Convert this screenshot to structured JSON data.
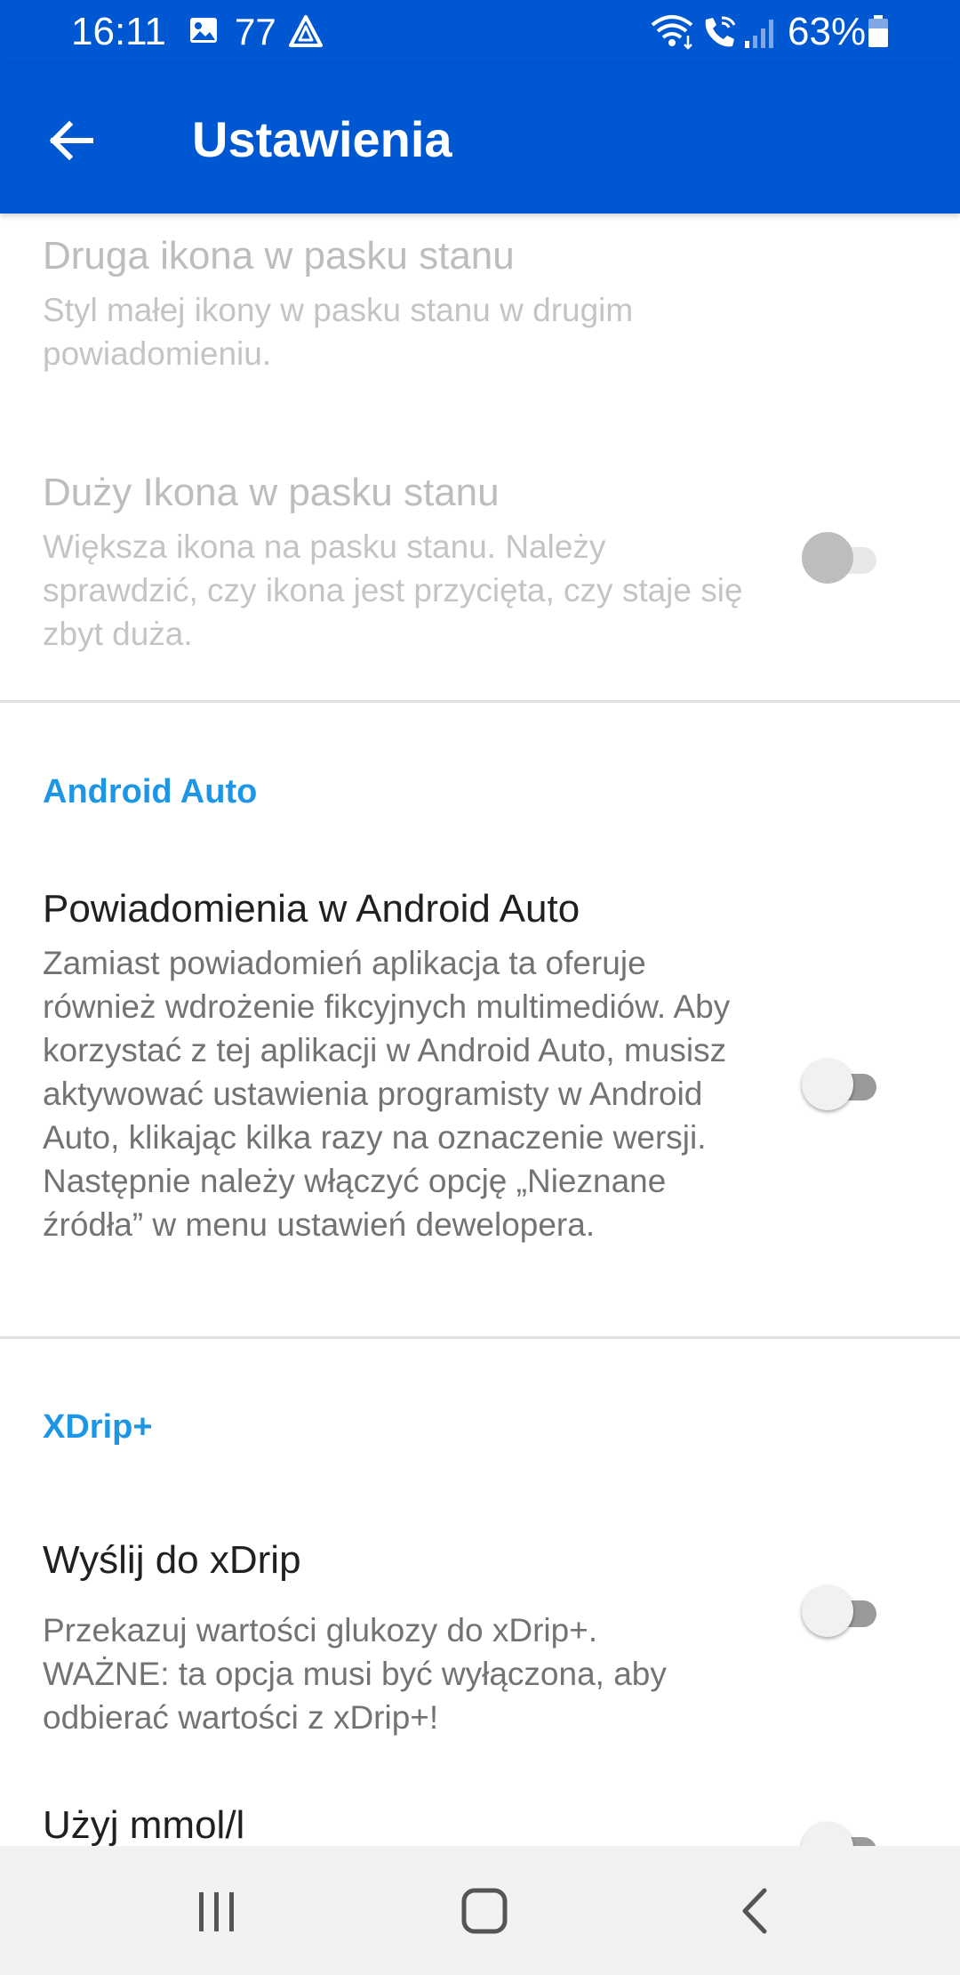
{
  "status_bar": {
    "time": "16:11",
    "notification_count": "77",
    "battery": "63%"
  },
  "app_bar": {
    "title": "Ustawienia"
  },
  "settings": {
    "second_icon": {
      "title": "Druga ikona w pasku stanu",
      "summary": "Styl małej ikony w pasku stanu w drugim powiadomieniu.",
      "enabled": false
    },
    "large_icon": {
      "title": "Duży Ikona w pasku stanu",
      "summary": "Większa ikona na pasku stanu. Należy sprawdzić, czy ikona jest przycięta, czy staje się zbyt duża.",
      "enabled": false,
      "checked": false
    },
    "android_auto_category": "Android Auto",
    "android_auto_notifications": {
      "title": "Powiadomienia w Android Auto",
      "summary": "Zamiast powiadomień aplikacja ta oferuje również wdrożenie fikcyjnych multimediów. Aby korzystać z tej aplikacji w Android Auto, musisz aktywować ustawienia programisty w Android Auto, klikając kilka razy na oznaczenie wersji. Następnie należy włączyć opcję „Nieznane źródła” w menu ustawień dewelopera.",
      "checked": false
    },
    "xdrip_category": "XDrip+",
    "send_to_xdrip": {
      "title": "Wyślij do xDrip",
      "summary": "Przekazuj wartości glukozy do xDrip+.\n WAŻNE: ta opcja musi być wyłączona, aby odbierać wartości z xDrip+!",
      "checked": false
    },
    "use_mmol": {
      "title": "Użyj mmol/l",
      "checked": false
    }
  },
  "colors": {
    "primary": "#0057d2",
    "category_accent": "#1e96e6",
    "navbar_bg": "#f2f2f2"
  },
  "icons": {
    "status": [
      "image-icon",
      "navigation-icon",
      "wifi-icon",
      "wifi-calling-icon",
      "signal-icon",
      "battery-icon"
    ],
    "app_bar": "arrow-back-icon",
    "nav_bar": [
      "recent-apps-icon",
      "home-icon",
      "back-icon"
    ]
  }
}
